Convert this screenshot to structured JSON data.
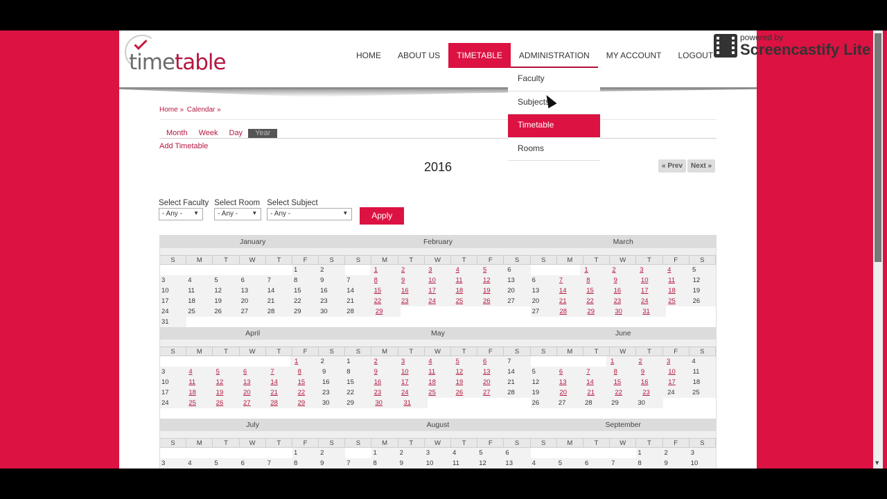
{
  "header": {
    "logo": {
      "part1": "time",
      "part2": "table"
    },
    "nav": [
      {
        "label": "HOME",
        "active": false
      },
      {
        "label": "ABOUT US",
        "active": false
      },
      {
        "label": "TIMETABLE",
        "active": true
      },
      {
        "label": "ADMINISTRATION",
        "active": false
      },
      {
        "label": "MY ACCOUNT",
        "active": false
      },
      {
        "label": "LOGOUT",
        "active": false
      }
    ],
    "admin_menu": [
      {
        "label": "Faculty",
        "active": false
      },
      {
        "label": "Subjects",
        "active": false
      },
      {
        "label": "Timetable",
        "active": true
      },
      {
        "label": "Rooms",
        "active": false
      }
    ]
  },
  "breadcrumb": [
    "Home »",
    "Calendar »"
  ],
  "view_tabs": [
    {
      "label": "Month",
      "active": false
    },
    {
      "label": "Week",
      "active": false
    },
    {
      "label": "Day",
      "active": false
    },
    {
      "label": "Year",
      "active": true
    }
  ],
  "add_link": "Add Timetable",
  "year": "2016",
  "pager": {
    "prev": "« Prev",
    "next": "Next »"
  },
  "filters": {
    "faculty": {
      "label": "Select Faculty",
      "value": "- Any -"
    },
    "room": {
      "label": "Select Room",
      "value": "- Any -"
    },
    "subject": {
      "label": "Select Subject",
      "value": "- Any -"
    },
    "apply": "Apply"
  },
  "weekdays": [
    "S",
    "M",
    "T",
    "W",
    "T",
    "F",
    "S"
  ],
  "months": [
    {
      "name": "January",
      "start": 5,
      "days": 31,
      "events": []
    },
    {
      "name": "February",
      "start": 1,
      "days": 29,
      "events": [
        1,
        2,
        3,
        4,
        5,
        8,
        9,
        10,
        11,
        12,
        15,
        16,
        17,
        18,
        19,
        22,
        23,
        24,
        25,
        26,
        29
      ]
    },
    {
      "name": "March",
      "start": 2,
      "days": 31,
      "events": [
        1,
        2,
        3,
        4,
        7,
        8,
        9,
        10,
        11,
        14,
        15,
        16,
        17,
        18,
        21,
        22,
        23,
        24,
        25,
        28,
        29,
        30,
        31
      ]
    },
    {
      "name": "April",
      "start": 5,
      "days": 30,
      "events": [
        1,
        4,
        5,
        6,
        7,
        8,
        11,
        12,
        13,
        14,
        15,
        18,
        19,
        20,
        21,
        22,
        25,
        26,
        27,
        28,
        29
      ]
    },
    {
      "name": "May",
      "start": 0,
      "days": 31,
      "events": [
        2,
        3,
        4,
        5,
        6,
        9,
        10,
        11,
        12,
        13,
        16,
        17,
        18,
        19,
        20,
        23,
        24,
        25,
        26,
        27,
        30,
        31
      ]
    },
    {
      "name": "June",
      "start": 3,
      "days": 30,
      "events": [
        1,
        2,
        3,
        6,
        7,
        8,
        9,
        10,
        13,
        14,
        15,
        16,
        17,
        20,
        21,
        22,
        23
      ]
    },
    {
      "name": "July",
      "start": 5,
      "days": 31,
      "events": []
    },
    {
      "name": "August",
      "start": 1,
      "days": 31,
      "events": []
    },
    {
      "name": "September",
      "start": 4,
      "days": 30,
      "events": []
    }
  ],
  "watermark": {
    "line1": "powered by",
    "line2": "Screencastify Lite"
  },
  "colors": {
    "accent": "#dc1242",
    "link": "#b5173f"
  }
}
